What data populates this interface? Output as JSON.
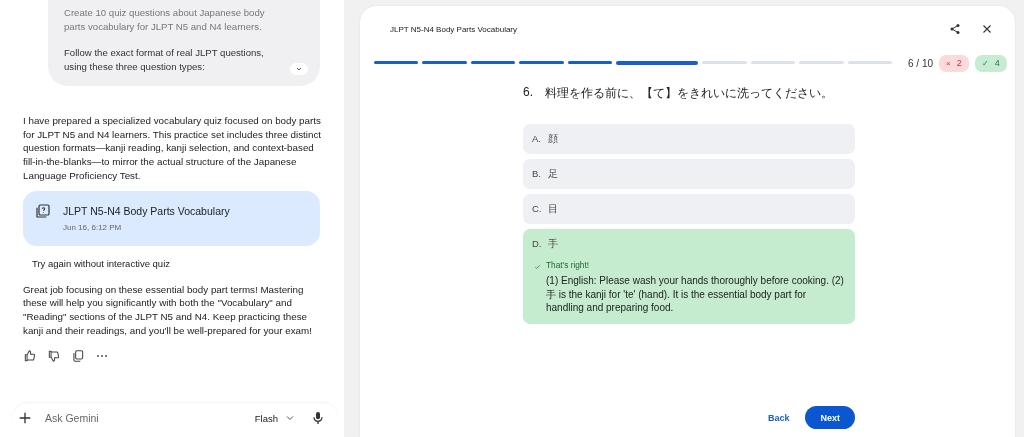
{
  "chat": {
    "user_message": [
      "Create 10 quiz questions about Japanese body parts vocabulary for JLPT N5 and N4 learners.",
      "Follow the exact format of real JLPT questions, using these three question types:"
    ],
    "response_intro": "I have prepared a specialized vocabulary quiz focused on body parts for JLPT N5 and N4 learners. This practice set includes three distinct question formats—kanji reading, kanji selection, and context-based fill-in-the-blanks—to mirror the actual structure of the Japanese Language Proficiency Test.",
    "quiz_card": {
      "title": "JLPT N5-N4 Body Parts Vocabulary",
      "date": "Jun 16, 6:12 PM"
    },
    "retry_link": "Try again without interactive quiz",
    "response_outro": "Great job focusing on these essential body part terms! Mastering these will help you significantly with both the \"Vocabulary\" and \"Reading\" sections of the JLPT N5 and N4. Keep practicing these kanji and their readings, and you'll be well-prepared for your exam!",
    "input": {
      "placeholder": "Ask Gemini",
      "model": "Flash"
    }
  },
  "quiz": {
    "title": "JLPT N5-N4 Body Parts Vocabulary",
    "progress": [
      {
        "kind": "done"
      },
      {
        "kind": "done"
      },
      {
        "kind": "done"
      },
      {
        "kind": "done"
      },
      {
        "kind": "done"
      },
      {
        "kind": "current"
      },
      {
        "kind": "todo"
      },
      {
        "kind": "todo"
      },
      {
        "kind": "todo"
      },
      {
        "kind": "todo"
      }
    ],
    "counter": "6 / 10",
    "wrong": {
      "icon": "×",
      "count": "2"
    },
    "right": {
      "icon": "✓",
      "count": "4"
    },
    "question": {
      "number": "6.",
      "text": "料理を作る前に、【て】をきれいに洗ってください。"
    },
    "options": [
      {
        "letter": "A.",
        "text": "顔",
        "selected": false
      },
      {
        "letter": "B.",
        "text": "足",
        "selected": false
      },
      {
        "letter": "C.",
        "text": "目",
        "selected": false
      },
      {
        "letter": "D.",
        "text": "手",
        "selected": true,
        "feedback": {
          "title": "That's right!",
          "text": "(1) English: Please wash your hands thoroughly before cooking. (2) 手 is the kanji for 'te' (hand). It is the essential body part for handling and preparing food."
        }
      }
    ],
    "buttons": {
      "back": "Back",
      "next": "Next"
    }
  }
}
